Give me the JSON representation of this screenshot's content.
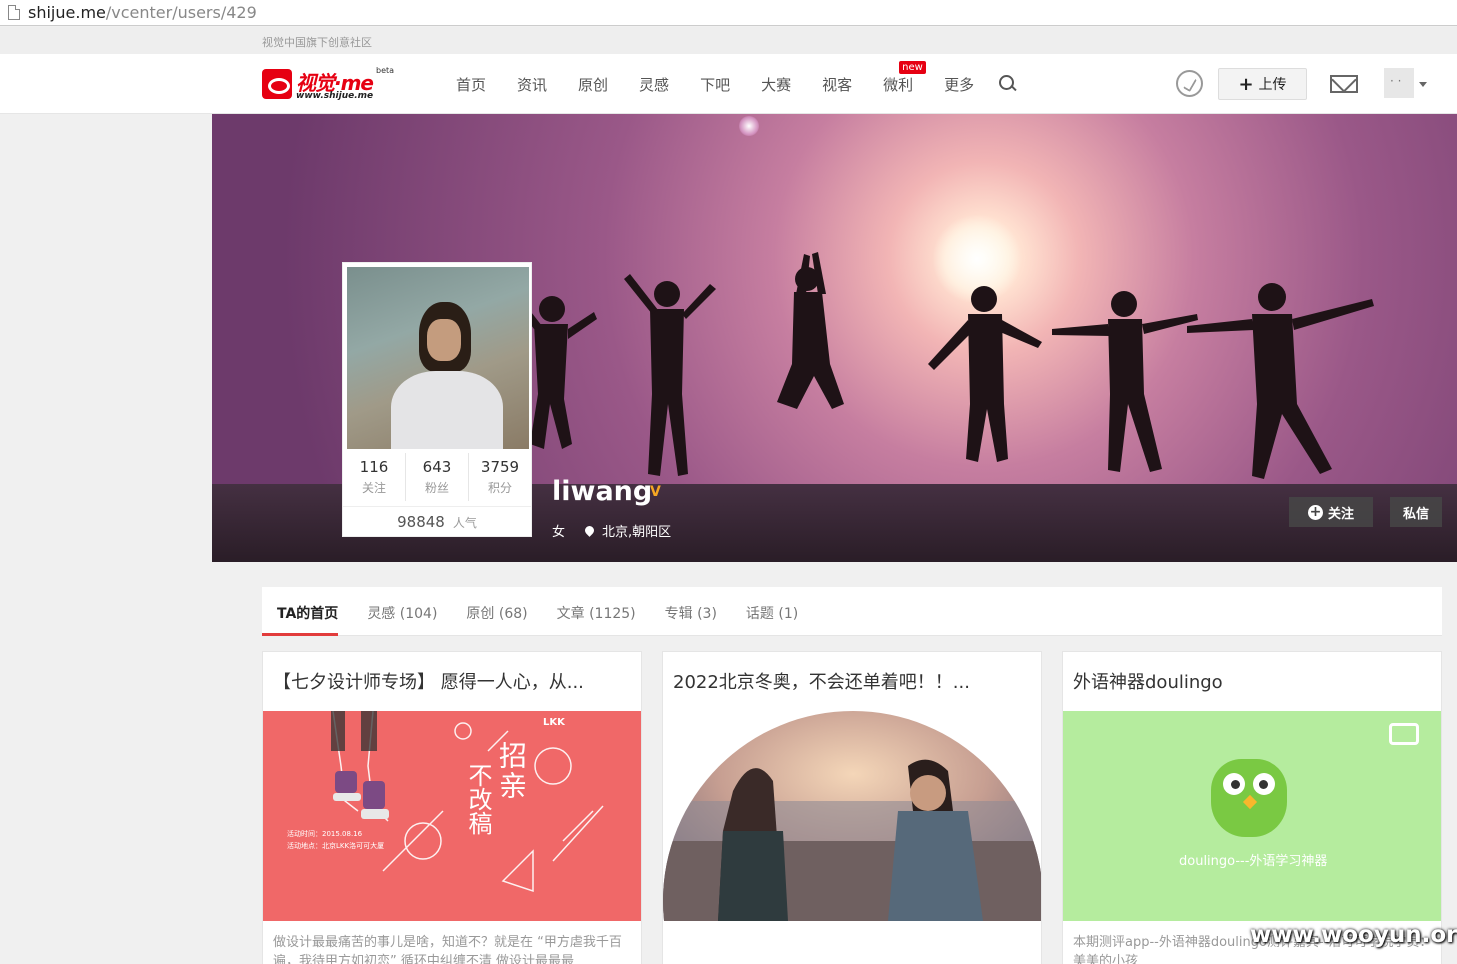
{
  "browser": {
    "url_host": "shijue.me",
    "url_path": "/vcenter/users/429"
  },
  "topstrip": {
    "slogan": "视觉中国旗下创意社区"
  },
  "logo": {
    "name": "视觉·me",
    "domain": "www.shijue.me",
    "beta": "beta"
  },
  "nav": {
    "items": [
      "首页",
      "资讯",
      "原创",
      "灵感",
      "下吧",
      "大赛",
      "视客",
      "微利",
      "更多"
    ],
    "badge": "new",
    "upload_label": "上传"
  },
  "profile": {
    "username": "liwang",
    "gender": "女",
    "location": "北京,朝阳区",
    "stats": [
      {
        "value": "116",
        "label": "关注"
      },
      {
        "value": "643",
        "label": "粉丝"
      },
      {
        "value": "3759",
        "label": "积分"
      }
    ],
    "popularity": {
      "value": "98848",
      "label": "人气"
    },
    "follow_label": "关注",
    "message_label": "私信"
  },
  "tabs": [
    "TA的首页",
    "灵感 (104)",
    "原创 (68)",
    "文章 (1125)",
    "专辑 (3)",
    "话题 (1)"
  ],
  "cards": [
    {
      "title": "【七夕设计师专场】 愿得一人心，从...",
      "desc": "做设计最最痛苦的事儿是啥，知道不？就是在 “甲方虐我千百遍，我待甲方如初恋” 循环中纠缠不清 做设计最最最",
      "poster_big": "招亲",
      "poster_big2": "不改稿",
      "poster_side": "活动地点：北京LKK洛可可大厦",
      "poster_time": "活动时间：2015.08.16",
      "poster_brand": "LKK"
    },
    {
      "title": "2022北京冬奥，不会还单着吧！！...",
      "desc": ""
    },
    {
      "title": "外语神器doulingo",
      "desc": "本期测评app--外语神器doulingo测评嘉宾--洛可可学院学员：美美的小孩",
      "poster_caption": "doulingo---外语学习神器"
    }
  ],
  "watermark": "www.wooyun.org"
}
